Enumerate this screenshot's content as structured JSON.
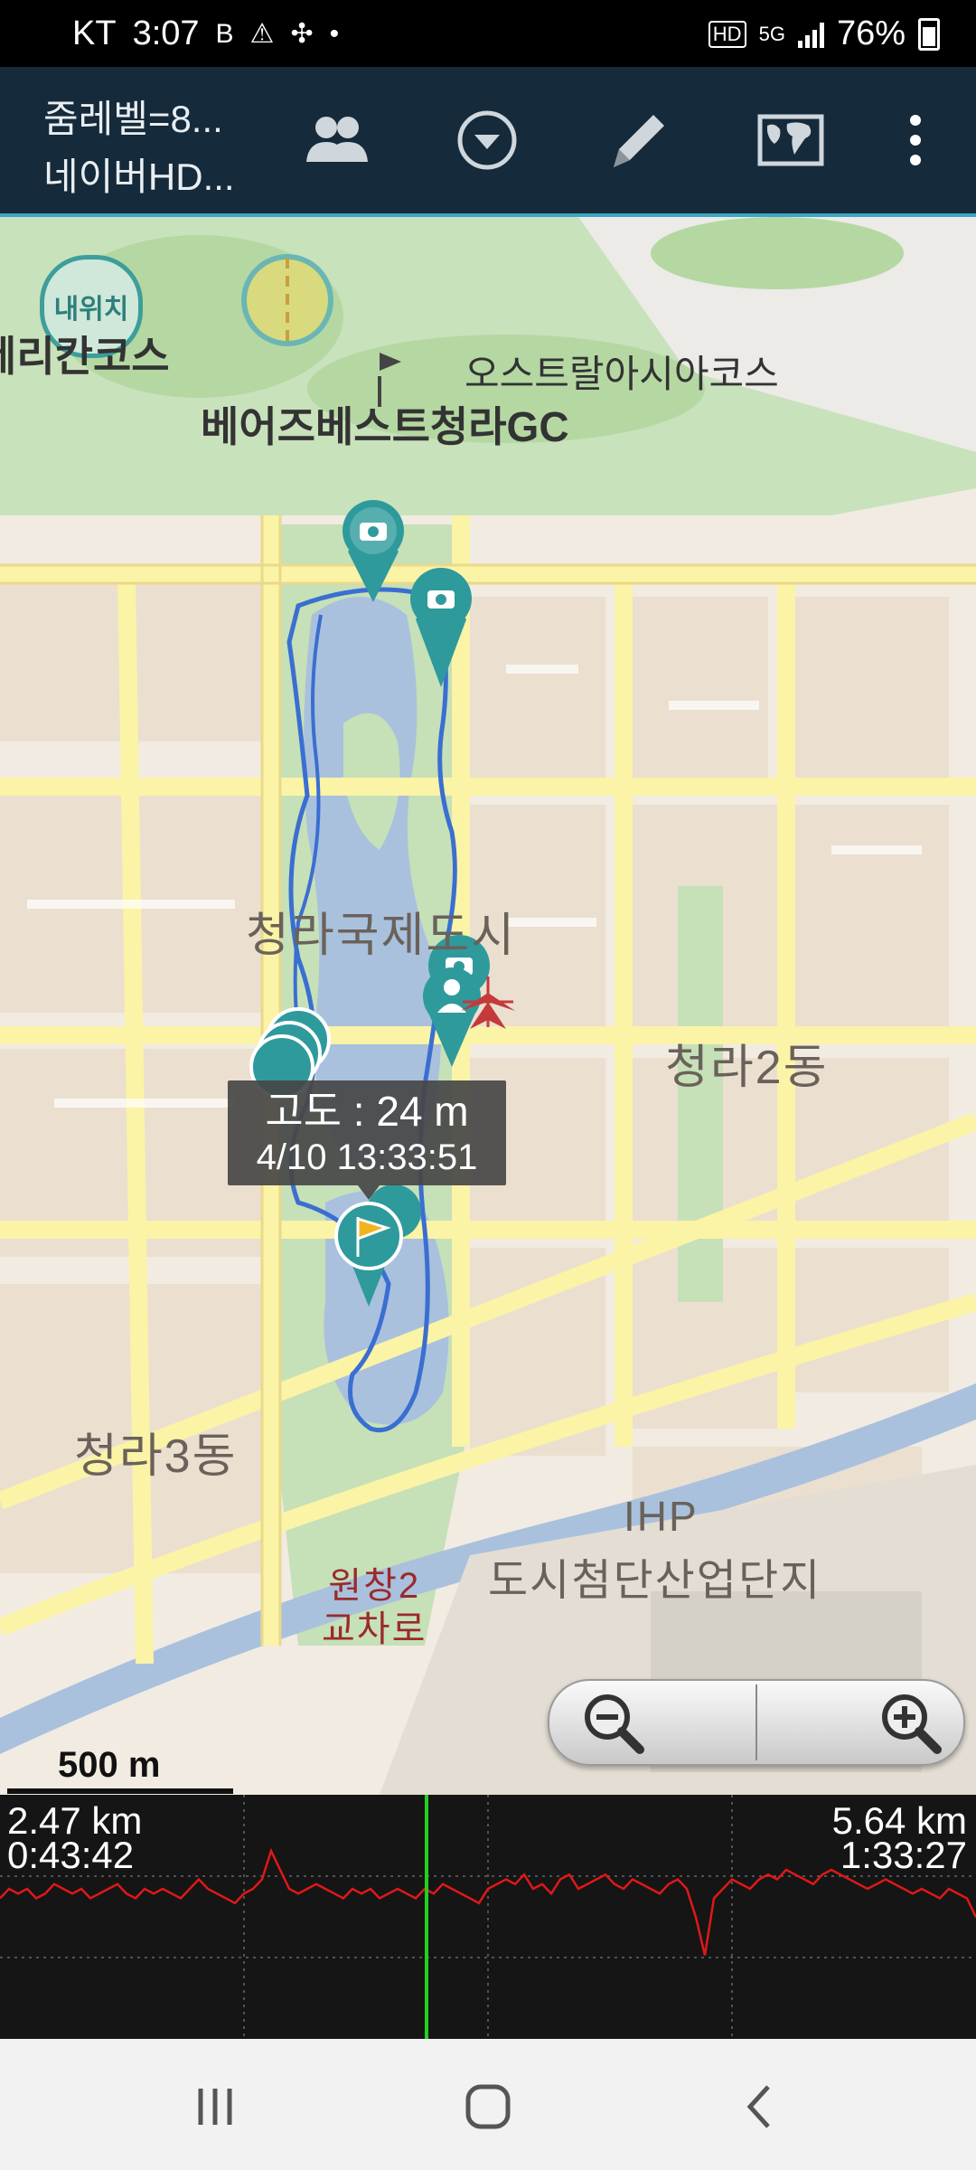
{
  "status_bar": {
    "carrier": "KT",
    "time": "3:07",
    "battery": "76%",
    "network": "5G"
  },
  "toolbar": {
    "title_line1": "줌레벨=8...",
    "title_line2": "네이버HD...",
    "buttons": [
      "group-icon",
      "dropdown-icon",
      "pencil-icon",
      "world-map-icon",
      "more-icon"
    ]
  },
  "map": {
    "labels": {
      "my_location": "내위치",
      "course_left": "제리칸코스",
      "course_right": "오스트랄아시아코스",
      "golf_club": "베어즈베스트청라GC",
      "city": "청라국제도시",
      "dong2": "청라2동",
      "dong3": "청라3동",
      "ihp": "IHP",
      "industrial": "도시첨단산업단지",
      "junction_line1": "원창2",
      "junction_line2": "교차로"
    },
    "tooltip": {
      "altitude": "고도 : 24 m",
      "datetime": "4/10 13:33:51"
    },
    "scale_label": "500 m",
    "colors": {
      "track": "#3a6fd1",
      "marker": "#2e9a9c",
      "water": "#a9c1dd",
      "park": "#c6e0b8",
      "road": "#fbf3a6"
    }
  },
  "elevation": {
    "left_distance": "2.47 km",
    "left_time": "0:43:42",
    "right_distance": "5.64 km",
    "right_time": "1:33:27",
    "line_color": "#e01818",
    "cursor_color": "#21d021",
    "profile": [
      22,
      24,
      23,
      24,
      22,
      23,
      25,
      24,
      23,
      24,
      22,
      23,
      24,
      25,
      23,
      22,
      24,
      23,
      24,
      23,
      22,
      24,
      26,
      24,
      23,
      22,
      21,
      23,
      24,
      26,
      32,
      28,
      24,
      23,
      24,
      25,
      24,
      23,
      22,
      24,
      23,
      24,
      22,
      23,
      24,
      23,
      22,
      24,
      23,
      25,
      24,
      23,
      22,
      21,
      24,
      25,
      26,
      25,
      27,
      24,
      25,
      23,
      26,
      27,
      24,
      25,
      26,
      27,
      25,
      24,
      26,
      25,
      24,
      23,
      25,
      26,
      24,
      18,
      10,
      22,
      24,
      26,
      25,
      24,
      26,
      27,
      26,
      28,
      27,
      26,
      25,
      27,
      28,
      27,
      26,
      25,
      24,
      25,
      26,
      25,
      24,
      23,
      24,
      23,
      22,
      24,
      23,
      22,
      18
    ]
  },
  "navbar": {
    "buttons": [
      "recent-apps-icon",
      "home-icon",
      "back-icon"
    ]
  }
}
